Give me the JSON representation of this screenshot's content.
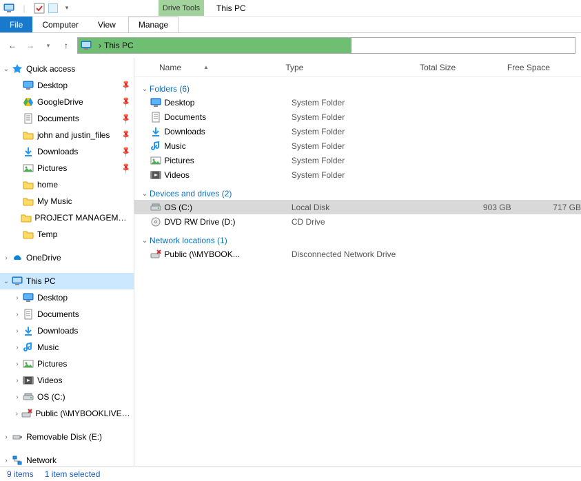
{
  "title": "This PC",
  "qat": {
    "dropdown_present": true
  },
  "drive_tools_label": "Drive Tools",
  "ribbon": {
    "file": "File",
    "computer": "Computer",
    "view": "View",
    "manage": "Manage"
  },
  "nav": {
    "back_enabled": true,
    "forward_enabled": false
  },
  "address": {
    "location": "This PC"
  },
  "columns": {
    "name": "Name",
    "type": "Type",
    "total_size": "Total Size",
    "free_space": "Free Space",
    "sort": "name"
  },
  "tree": [
    {
      "depth": 0,
      "icon": "star",
      "label": "Quick access",
      "expander": "open"
    },
    {
      "depth": 1,
      "icon": "desktop",
      "label": "Desktop",
      "pinned": true
    },
    {
      "depth": 1,
      "icon": "gdrive",
      "label": "GoogleDrive",
      "pinned": true
    },
    {
      "depth": 1,
      "icon": "documents",
      "label": "Documents",
      "pinned": true
    },
    {
      "depth": 1,
      "icon": "folder",
      "label": "john and justin_files",
      "pinned": true
    },
    {
      "depth": 1,
      "icon": "downloads",
      "label": "Downloads",
      "pinned": true
    },
    {
      "depth": 1,
      "icon": "pictures",
      "label": "Pictures",
      "pinned": true
    },
    {
      "depth": 1,
      "icon": "folder",
      "label": "home"
    },
    {
      "depth": 1,
      "icon": "folder",
      "label": "My Music"
    },
    {
      "depth": 1,
      "icon": "folder",
      "label": "PROJECT MANAGEMENT ar"
    },
    {
      "depth": 1,
      "icon": "folder",
      "label": "Temp"
    },
    {
      "spacer": true
    },
    {
      "depth": 0,
      "icon": "onedrive",
      "label": "OneDrive",
      "expander": "closed"
    },
    {
      "spacer": true
    },
    {
      "depth": 0,
      "icon": "thispc",
      "label": "This PC",
      "expander": "open",
      "selected": true
    },
    {
      "depth": 1,
      "icon": "desktop",
      "label": "Desktop",
      "expander": "closed"
    },
    {
      "depth": 1,
      "icon": "documents",
      "label": "Documents",
      "expander": "closed"
    },
    {
      "depth": 1,
      "icon": "downloads",
      "label": "Downloads",
      "expander": "closed"
    },
    {
      "depth": 1,
      "icon": "music",
      "label": "Music",
      "expander": "closed"
    },
    {
      "depth": 1,
      "icon": "pictures",
      "label": "Pictures",
      "expander": "closed"
    },
    {
      "depth": 1,
      "icon": "videos",
      "label": "Videos",
      "expander": "closed"
    },
    {
      "depth": 1,
      "icon": "drive",
      "label": "OS (C:)",
      "expander": "closed"
    },
    {
      "depth": 1,
      "icon": "netdrive-x",
      "label": "Public (\\\\MYBOOKLIVEDUC",
      "expander": "closed"
    },
    {
      "spacer": true
    },
    {
      "depth": 0,
      "icon": "usb",
      "label": "Removable Disk (E:)",
      "expander": "closed"
    },
    {
      "spacer": true
    },
    {
      "depth": 0,
      "icon": "network",
      "label": "Network",
      "expander": "closed"
    }
  ],
  "groups": [
    {
      "title": "Folders (6)",
      "rows": [
        {
          "icon": "desktop",
          "name": "Desktop",
          "type": "System Folder"
        },
        {
          "icon": "documents",
          "name": "Documents",
          "type": "System Folder"
        },
        {
          "icon": "downloads",
          "name": "Downloads",
          "type": "System Folder"
        },
        {
          "icon": "music",
          "name": "Music",
          "type": "System Folder"
        },
        {
          "icon": "pictures",
          "name": "Pictures",
          "type": "System Folder"
        },
        {
          "icon": "videos",
          "name": "Videos",
          "type": "System Folder"
        }
      ]
    },
    {
      "title": "Devices and drives (2)",
      "rows": [
        {
          "icon": "drive",
          "name": "OS (C:)",
          "type": "Local Disk",
          "size": "903 GB",
          "free": "717 GB",
          "selected": true
        },
        {
          "icon": "dvd",
          "name": "DVD RW Drive (D:)",
          "type": "CD Drive"
        }
      ]
    },
    {
      "title": "Network locations (1)",
      "rows": [
        {
          "icon": "netdrive-x",
          "name": "Public (\\\\MYBOOK...",
          "type": "Disconnected Network Drive"
        }
      ]
    }
  ],
  "status": {
    "items": "9 items",
    "selected": "1 item selected"
  }
}
